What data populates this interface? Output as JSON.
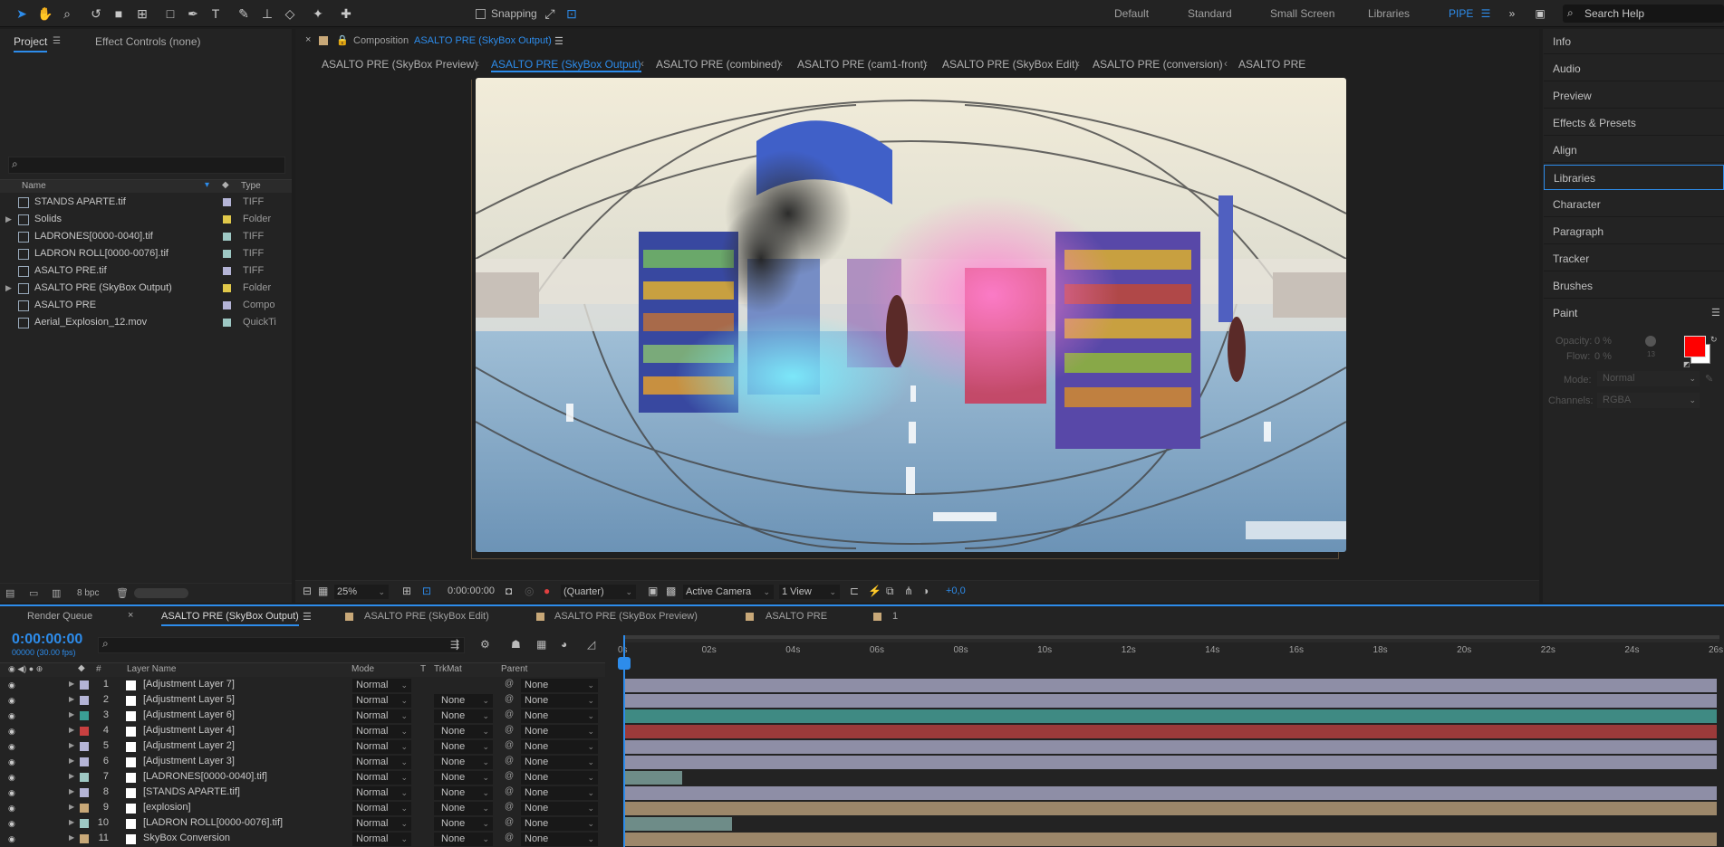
{
  "toolbar": {
    "snapping_label": "Snapping",
    "workspaces": [
      "Default",
      "Standard",
      "Small Screen",
      "Libraries",
      "PIPE"
    ],
    "search_placeholder": "Search Help"
  },
  "project_panel": {
    "tab_project": "Project",
    "tab_effect_controls": "Effect Controls (none)",
    "col_name": "Name",
    "col_type": "Type",
    "items": [
      {
        "name": "STANDS APARTE.tif",
        "type": "TIFF",
        "color": "#b4b4d6"
      },
      {
        "name": "Solids",
        "type": "Folder",
        "color": "#e0c84a"
      },
      {
        "name": "LADRONES[0000-0040].tif",
        "type": "TIFF",
        "color": "#9ec8c4"
      },
      {
        "name": "LADRON ROLL[0000-0076].tif",
        "type": "TIFF",
        "color": "#9ec8c4"
      },
      {
        "name": "ASALTO PRE.tif",
        "type": "TIFF",
        "color": "#b4b4d6"
      },
      {
        "name": "ASALTO PRE (SkyBox Output)",
        "type": "Folder",
        "color": "#e0c84a"
      },
      {
        "name": "ASALTO PRE",
        "type": "Compo",
        "color": "#b4b4d6"
      },
      {
        "name": "Aerial_Explosion_12.mov",
        "type": "QuickTi",
        "color": "#9ec8c4"
      }
    ],
    "bpc": "8 bpc"
  },
  "composition": {
    "header_prefix": "Composition",
    "header_name": "ASALTO PRE (SkyBox Output)",
    "breadcrumbs": [
      "ASALTO PRE (SkyBox Preview)",
      "ASALTO PRE (SkyBox Output)",
      "ASALTO PRE (combined)",
      "ASALTO PRE (cam1-front)",
      "ASALTO PRE (SkyBox Edit)",
      "ASALTO PRE (conversion)",
      "ASALTO PRE"
    ],
    "zoom": "25%",
    "timecode": "0:00:00:00",
    "resolution": "(Quarter)",
    "camera": "Active Camera",
    "views": "1 View",
    "exposure": "+0,0"
  },
  "right_panel": {
    "items": [
      "Info",
      "Audio",
      "Preview",
      "Effects & Presets",
      "Align",
      "Libraries",
      "Character",
      "Paragraph",
      "Tracker",
      "Brushes"
    ],
    "paint": {
      "title": "Paint",
      "opacity_label": "Opacity:",
      "opacity_value": "0 %",
      "flow_label": "Flow:",
      "flow_value": "0 %",
      "mode_label": "Mode:",
      "mode_value": "Normal",
      "channels_label": "Channels:",
      "channels_value": "RGBA",
      "brush_size": "13",
      "fg_color": "#ff0000",
      "bg_color": "#ffffff"
    }
  },
  "timeline": {
    "tabs": [
      "Render Queue",
      "ASALTO PRE (SkyBox Output)",
      "ASALTO PRE (SkyBox Edit)",
      "ASALTO PRE (SkyBox Preview)",
      "ASALTO PRE",
      "1"
    ],
    "timecode": "0:00:00:00",
    "frame_info": "00000 (30.00 fps)",
    "columns": {
      "num": "#",
      "layer_name": "Layer Name",
      "mode": "Mode",
      "t": "T",
      "trkmat": "TrkMat",
      "parent": "Parent"
    },
    "ruler": [
      "0s",
      "02s",
      "04s",
      "06s",
      "08s",
      "10s",
      "12s",
      "14s",
      "16s",
      "18s",
      "20s",
      "22s",
      "24s",
      "26s"
    ],
    "layers": [
      {
        "num": "1",
        "name": "[Adjustment Layer 7]",
        "mode": "Normal",
        "trkmat": "",
        "parent": "None",
        "label": "#b4b4d6",
        "bar": "#8e8ea6",
        "span": 1.0
      },
      {
        "num": "2",
        "name": "[Adjustment Layer 5]",
        "mode": "Normal",
        "trkmat": "None",
        "parent": "None",
        "label": "#b4b4d6",
        "bar": "#8e8ea6",
        "span": 1.0
      },
      {
        "num": "3",
        "name": "[Adjustment Layer 6]",
        "mode": "Normal",
        "trkmat": "None",
        "parent": "None",
        "label": "#3a9e94",
        "bar": "#3f8a83",
        "span": 1.0
      },
      {
        "num": "4",
        "name": "[Adjustment Layer 4]",
        "mode": "Normal",
        "trkmat": "None",
        "parent": "None",
        "label": "#c84040",
        "bar": "#9c3a3a",
        "span": 1.0
      },
      {
        "num": "5",
        "name": "[Adjustment Layer 2]",
        "mode": "Normal",
        "trkmat": "None",
        "parent": "None",
        "label": "#b4b4d6",
        "bar": "#8e8ea6",
        "span": 1.0
      },
      {
        "num": "6",
        "name": "[Adjustment Layer 3]",
        "mode": "Normal",
        "trkmat": "None",
        "parent": "None",
        "label": "#b4b4d6",
        "bar": "#8e8ea6",
        "span": 1.0
      },
      {
        "num": "7",
        "name": "[LADRONES[0000-0040].tif]",
        "mode": "Normal",
        "trkmat": "None",
        "parent": "None",
        "label": "#9ec8c4",
        "bar": "#6e8c88",
        "span": 0.052
      },
      {
        "num": "8",
        "name": "[STANDS APARTE.tif]",
        "mode": "Normal",
        "trkmat": "None",
        "parent": "None",
        "label": "#b4b4d6",
        "bar": "#8e8ea6",
        "span": 1.0
      },
      {
        "num": "9",
        "name": "[explosion]",
        "mode": "Normal",
        "trkmat": "None",
        "parent": "None",
        "label": "#c8a878",
        "bar": "#9c876a",
        "span": 1.0
      },
      {
        "num": "10",
        "name": "[LADRON ROLL[0000-0076].tif]",
        "mode": "Normal",
        "trkmat": "None",
        "parent": "None",
        "label": "#9ec8c4",
        "bar": "#6e8c88",
        "span": 0.098
      },
      {
        "num": "11",
        "name": "SkyBox Conversion",
        "mode": "Normal",
        "trkmat": "None",
        "parent": "None",
        "label": "#c8a878",
        "bar": "#9c876a",
        "span": 1.0
      }
    ]
  }
}
